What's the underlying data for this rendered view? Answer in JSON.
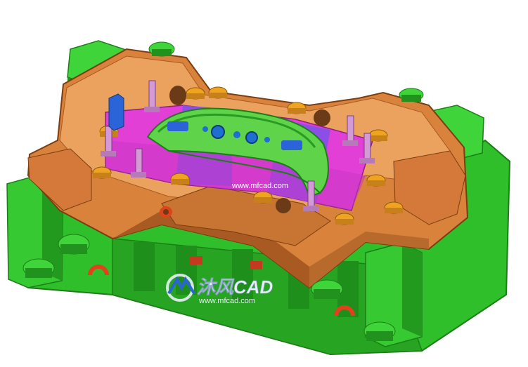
{
  "watermark": {
    "top_url": "www.mfcad.com",
    "brand": "沐风CAD",
    "bottom_url": "www.mfcad.com"
  },
  "colors": {
    "die_base": "#d9823c",
    "die_base_dark": "#a85a22",
    "die_base_light": "#eba25e",
    "clamp_green": "#2fbf2a",
    "clamp_green_dark": "#1d7d18",
    "cavity_magenta": "#e23fd6",
    "cavity_purple": "#8b4fe6",
    "part_green": "#5fd44a",
    "guide_pin": "#f0a321",
    "pillar_pink": "#d49ad6",
    "block_blue": "#2a64d8",
    "hook_red": "#e0421c"
  },
  "icons": {
    "logo": "mfcad-logo-icon"
  }
}
